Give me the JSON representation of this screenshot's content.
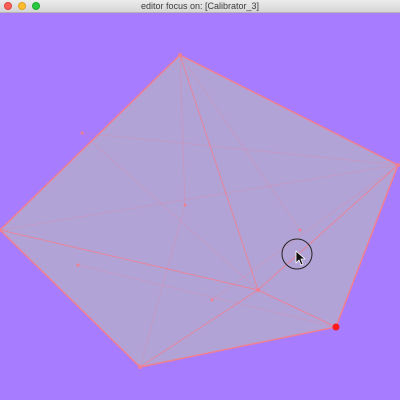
{
  "window": {
    "title": "editor focus on: [Calibrator_3]"
  },
  "colors": {
    "background": "#a77cfe",
    "mesh_fill": "#b2a3d6",
    "mesh_edge": "#f07f92",
    "selected_vertex": "#ff1a1a"
  },
  "icons": {
    "cursor": "arrow-cursor-icon",
    "brush": "brush-circle-icon"
  }
}
